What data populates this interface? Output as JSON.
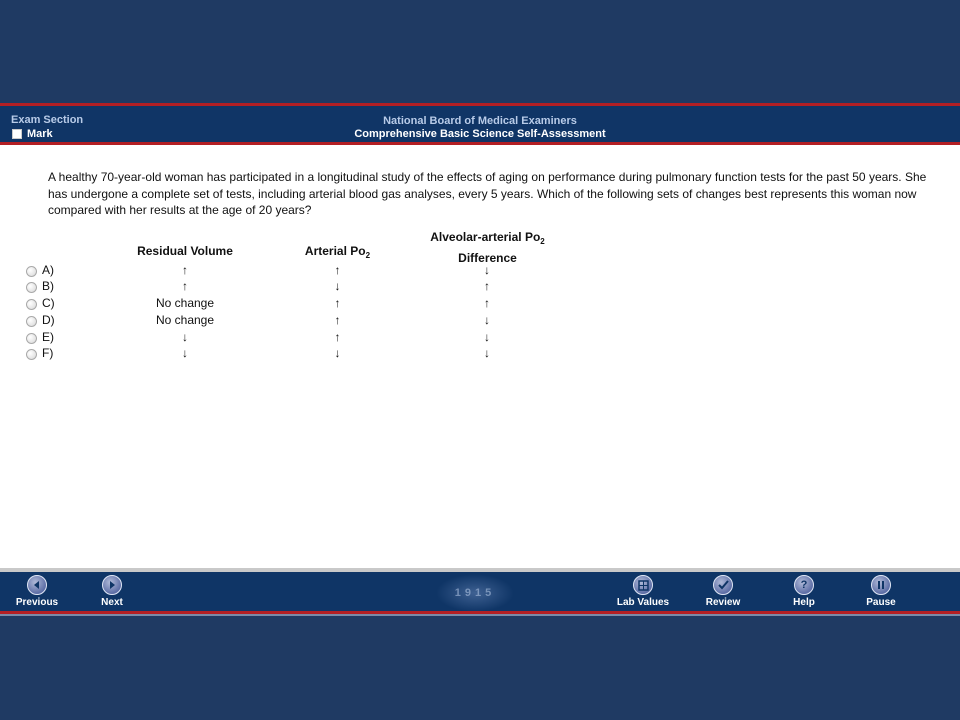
{
  "header": {
    "section_label": "Exam Section",
    "mark_label": "Mark",
    "title": "National Board of Medical Examiners",
    "subtitle": "Comprehensive Basic Science Self-Assessment"
  },
  "question": {
    "stem": "A healthy 70-year-old woman has participated in a longitudinal study of the effects of aging on performance during pulmonary function tests for the past 50 years. She has undergone a complete set of tests, including arterial blood gas analyses, every 5 years. Which of the following sets of changes best represents this woman now compared with her results at the age of 20 years?",
    "columns": {
      "residual": "Residual Volume",
      "arterial": "Arterial Po",
      "arterial_sub": "2",
      "alveolar_line1": "Alveolar-arterial Po",
      "alveolar_sub": "2",
      "alveolar_line2": "Difference"
    },
    "options": [
      {
        "letter": "A)",
        "residual": "↑",
        "arterial": "↑",
        "alveolar": "↓"
      },
      {
        "letter": "B)",
        "residual": "↑",
        "arterial": "↓",
        "alveolar": "↑"
      },
      {
        "letter": "C)",
        "residual": "No change",
        "arterial": "↑",
        "alveolar": "↑"
      },
      {
        "letter": "D)",
        "residual": "No change",
        "arterial": "↑",
        "alveolar": "↓"
      },
      {
        "letter": "E)",
        "residual": "↓",
        "arterial": "↑",
        "alveolar": "↓"
      },
      {
        "letter": "F)",
        "residual": "↓",
        "arterial": "↓",
        "alveolar": "↓"
      }
    ]
  },
  "footer": {
    "previous": "Previous",
    "next": "Next",
    "seal_text": "1915",
    "lab_values": "Lab Values",
    "review": "Review",
    "help": "Help",
    "pause": "Pause"
  },
  "colors": {
    "navy": "#103566",
    "red_stripe": "#b31f24",
    "page_bg": "#1f3a63"
  }
}
